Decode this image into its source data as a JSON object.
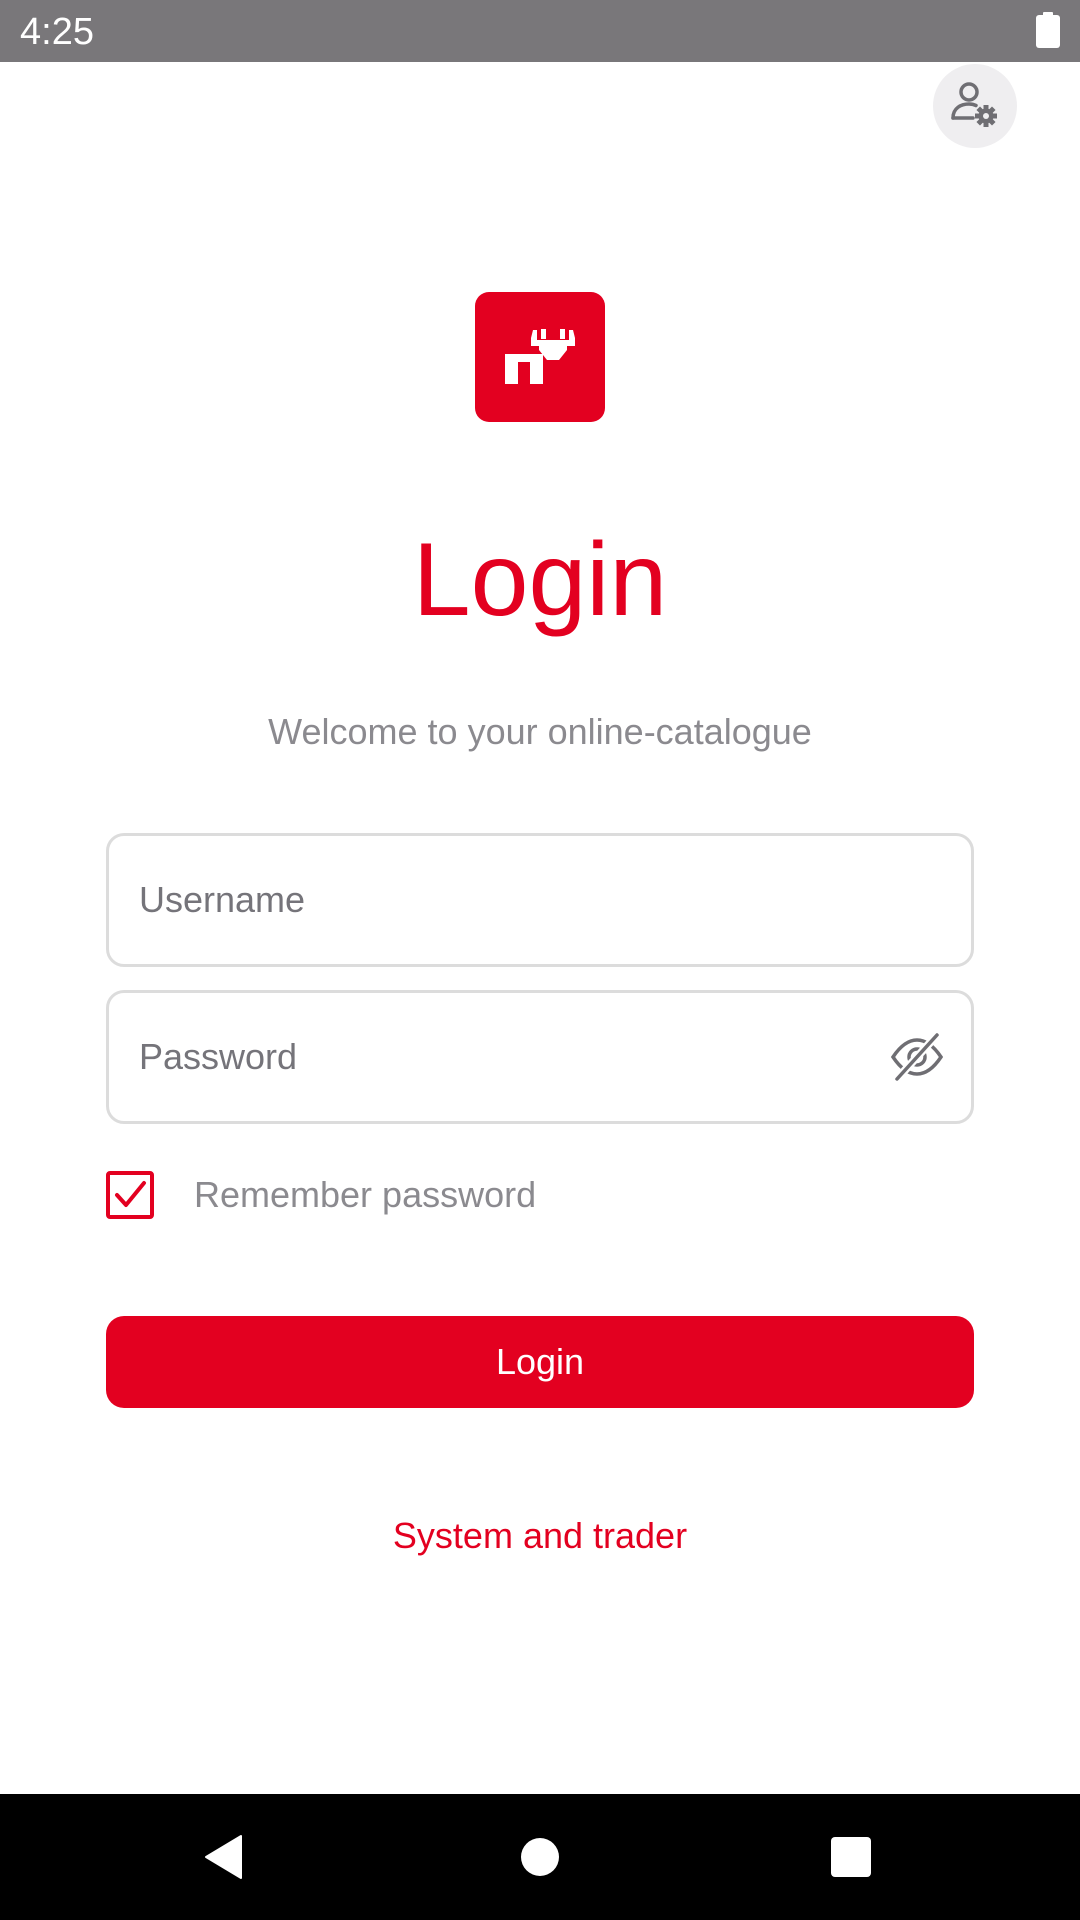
{
  "status_bar": {
    "time": "4:25",
    "battery_icon": "battery-full-icon",
    "background": "#79777a"
  },
  "header": {
    "settings_icon": "account-settings-icon"
  },
  "logo": {
    "icon": "brand-logo-icon",
    "color": "#e30020"
  },
  "login": {
    "title": "Login",
    "subtitle": "Welcome to your online-catalogue",
    "username": {
      "placeholder": "Username",
      "value": ""
    },
    "password": {
      "placeholder": "Password",
      "value": "",
      "toggle_icon": "visibility-off-icon"
    },
    "remember_password": {
      "label": "Remember password",
      "checked": true
    },
    "submit_label": "Login",
    "system_link": "System and trader"
  },
  "nav_bar": {
    "back_icon": "back-triangle-icon",
    "home_icon": "home-circle-icon",
    "recents_icon": "recents-square-icon"
  },
  "colors": {
    "accent": "#e30020",
    "muted_text": "#8b8a8f",
    "field_border": "#dcdcdc"
  }
}
